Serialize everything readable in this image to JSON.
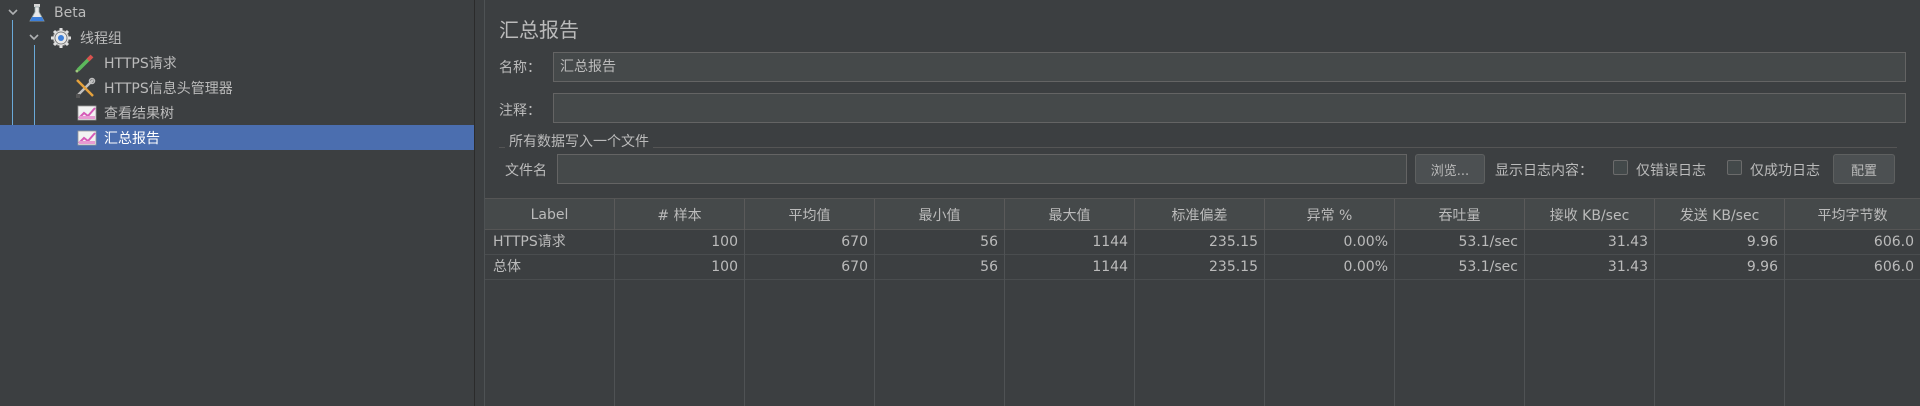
{
  "tree": {
    "root": {
      "label": "Beta",
      "icon": "flask-icon"
    },
    "thread_group": {
      "label": "线程组",
      "icon": "gear-icon"
    },
    "children": [
      {
        "label": "HTTPS请求",
        "icon": "pipette-icon"
      },
      {
        "label": "HTTPS信息头管理器",
        "icon": "wrench-icon"
      },
      {
        "label": "查看结果树",
        "icon": "chart-icon"
      },
      {
        "label": "汇总报告",
        "icon": "chart-icon",
        "selected": true
      }
    ]
  },
  "panel": {
    "title": "汇总报告",
    "name_label": "名称：",
    "name_value": "汇总报告",
    "comment_label": "注释：",
    "comment_value": "",
    "file_group_title": "所有数据写入一个文件",
    "file_label": "文件名",
    "file_value": "",
    "browse_button": "浏览...",
    "log_content_label": "显示日志内容：",
    "errors_only_label": "仅错误日志",
    "success_only_label": "仅成功日志",
    "config_button": "配置"
  },
  "table": {
    "headers": [
      "Label",
      "# 样本",
      "平均值",
      "最小值",
      "最大值",
      "标准偏差",
      "异常 %",
      "吞吐量",
      "接收 KB/sec",
      "发送 KB/sec",
      "平均字节数"
    ],
    "rows": [
      [
        "HTTPS请求",
        "100",
        "670",
        "56",
        "1144",
        "235.15",
        "0.00%",
        "53.1/sec",
        "31.43",
        "9.96",
        "606.0"
      ],
      [
        "总体",
        "100",
        "670",
        "56",
        "1144",
        "235.15",
        "0.00%",
        "53.1/sec",
        "31.43",
        "9.96",
        "606.0"
      ]
    ]
  },
  "colors": {
    "background": "#3c3f41",
    "selection": "#4b6eaf",
    "text": "#bbbbbb"
  }
}
